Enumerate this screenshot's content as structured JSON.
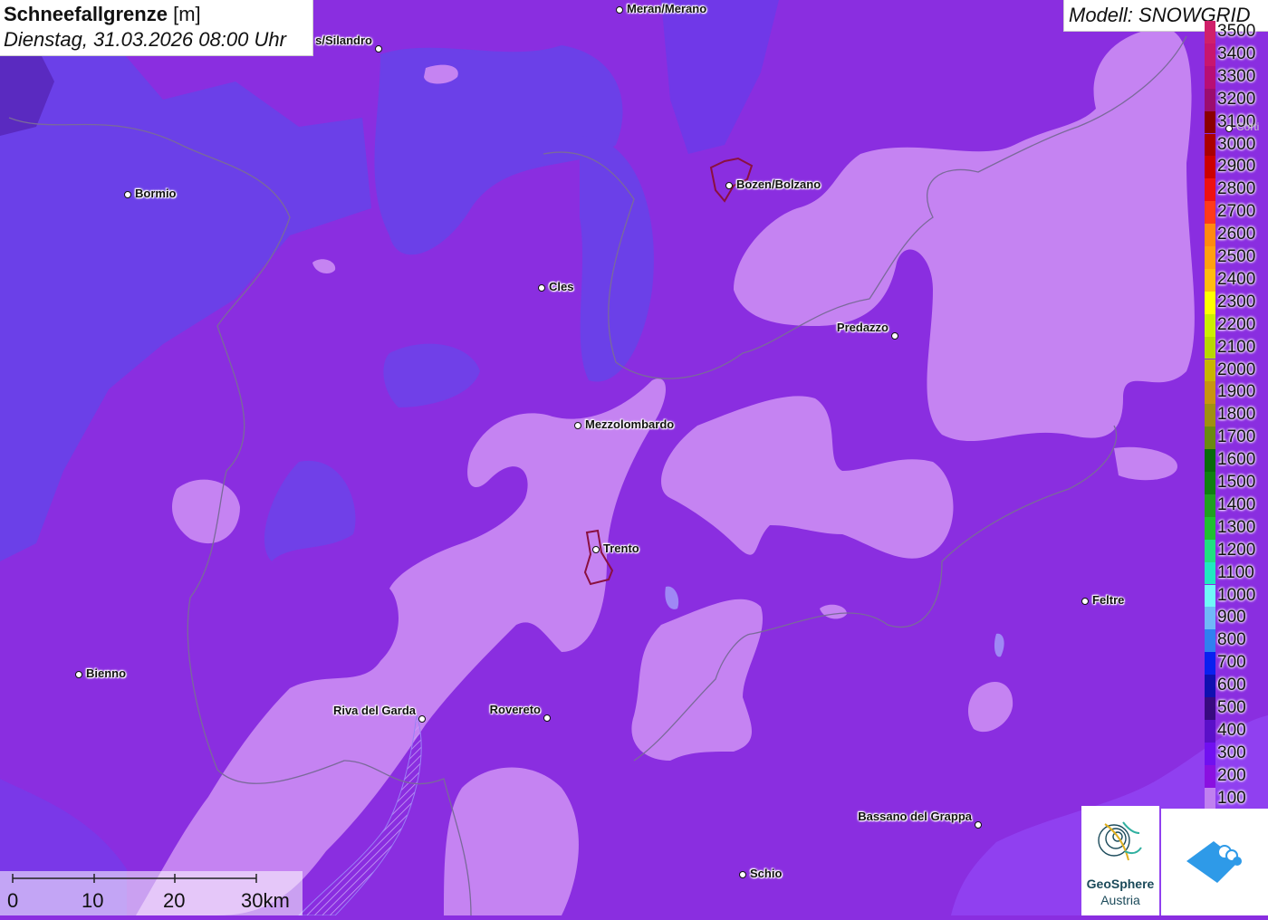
{
  "header": {
    "title_bold": "Schneefallgrenze",
    "title_unit": "[m]",
    "datetime": "Dienstag, 31.03.2026 08:00 Uhr"
  },
  "model": {
    "label": "Modell: SNOWGRID"
  },
  "legend": {
    "items": [
      {
        "label": "3500",
        "color": "#d0206a"
      },
      {
        "label": "3400",
        "color": "#c8166e"
      },
      {
        "label": "3300",
        "color": "#b80e74"
      },
      {
        "label": "3200",
        "color": "#9c0d6e"
      },
      {
        "label": "3100",
        "color": "#8a0000"
      },
      {
        "label": "3000",
        "color": "#aa0000"
      },
      {
        "label": "2900",
        "color": "#cc0000"
      },
      {
        "label": "2800",
        "color": "#ee1111"
      },
      {
        "label": "2700",
        "color": "#ff3a1a"
      },
      {
        "label": "2600",
        "color": "#ff8a10"
      },
      {
        "label": "2500",
        "color": "#ffa010"
      },
      {
        "label": "2400",
        "color": "#ffbb10"
      },
      {
        "label": "2300",
        "color": "#ffff00"
      },
      {
        "label": "2200",
        "color": "#ccee00"
      },
      {
        "label": "2100",
        "color": "#b8d800"
      },
      {
        "label": "2000",
        "color": "#c8b400"
      },
      {
        "label": "1900",
        "color": "#c89410"
      },
      {
        "label": "1800",
        "color": "#a09010"
      },
      {
        "label": "1700",
        "color": "#6a8a10"
      },
      {
        "label": "1600",
        "color": "#0a6a0a"
      },
      {
        "label": "1500",
        "color": "#108010"
      },
      {
        "label": "1400",
        "color": "#20a020"
      },
      {
        "label": "1300",
        "color": "#20c030"
      },
      {
        "label": "1200",
        "color": "#20e080"
      },
      {
        "label": "1100",
        "color": "#20e8c0"
      },
      {
        "label": "1000",
        "color": "#70f8f8"
      },
      {
        "label": "900",
        "color": "#70b8f8"
      },
      {
        "label": "800",
        "color": "#3080f0"
      },
      {
        "label": "700",
        "color": "#0a20f0"
      },
      {
        "label": "600",
        "color": "#1010b0"
      },
      {
        "label": "500",
        "color": "#380a80"
      },
      {
        "label": "400",
        "color": "#5a10c8"
      },
      {
        "label": "300",
        "color": "#7010f0"
      },
      {
        "label": "200",
        "color": "#8a10e0"
      },
      {
        "label": "100",
        "color": "#c080f0"
      }
    ]
  },
  "cities": [
    {
      "name": "Meran/Merano",
      "dot_side": "left"
    },
    {
      "name": "s/Silandro",
      "dot_side": "right"
    },
    {
      "name": "Bormio",
      "dot_side": "left"
    },
    {
      "name": "Bozen/Bolzano",
      "dot_side": "left"
    },
    {
      "name": "Cles",
      "dot_side": "left"
    },
    {
      "name": "Predazzo",
      "dot_side": "right"
    },
    {
      "name": "Mezzolombardo",
      "dot_side": "left"
    },
    {
      "name": "Trento",
      "dot_side": "left"
    },
    {
      "name": "Feltre",
      "dot_side": "left"
    },
    {
      "name": "Bienno",
      "dot_side": "left"
    },
    {
      "name": "Riva del Garda",
      "dot_side": "right"
    },
    {
      "name": "Rovereto",
      "dot_side": "right"
    },
    {
      "name": "Bassano del Grappa",
      "dot_side": "right"
    },
    {
      "name": "Schio",
      "dot_side": "left"
    },
    {
      "name": "Corti",
      "dot_side": "left"
    }
  ],
  "scalebar": {
    "labels": [
      "0",
      "10",
      "20",
      "30km"
    ]
  },
  "logos": {
    "geosphere_line1": "GeoSphere",
    "geosphere_line2": "Austria"
  },
  "colors": {
    "base": "#8a2ee0",
    "low_snowline": "#c481f2",
    "blue_zone": "#6a3ae8"
  }
}
